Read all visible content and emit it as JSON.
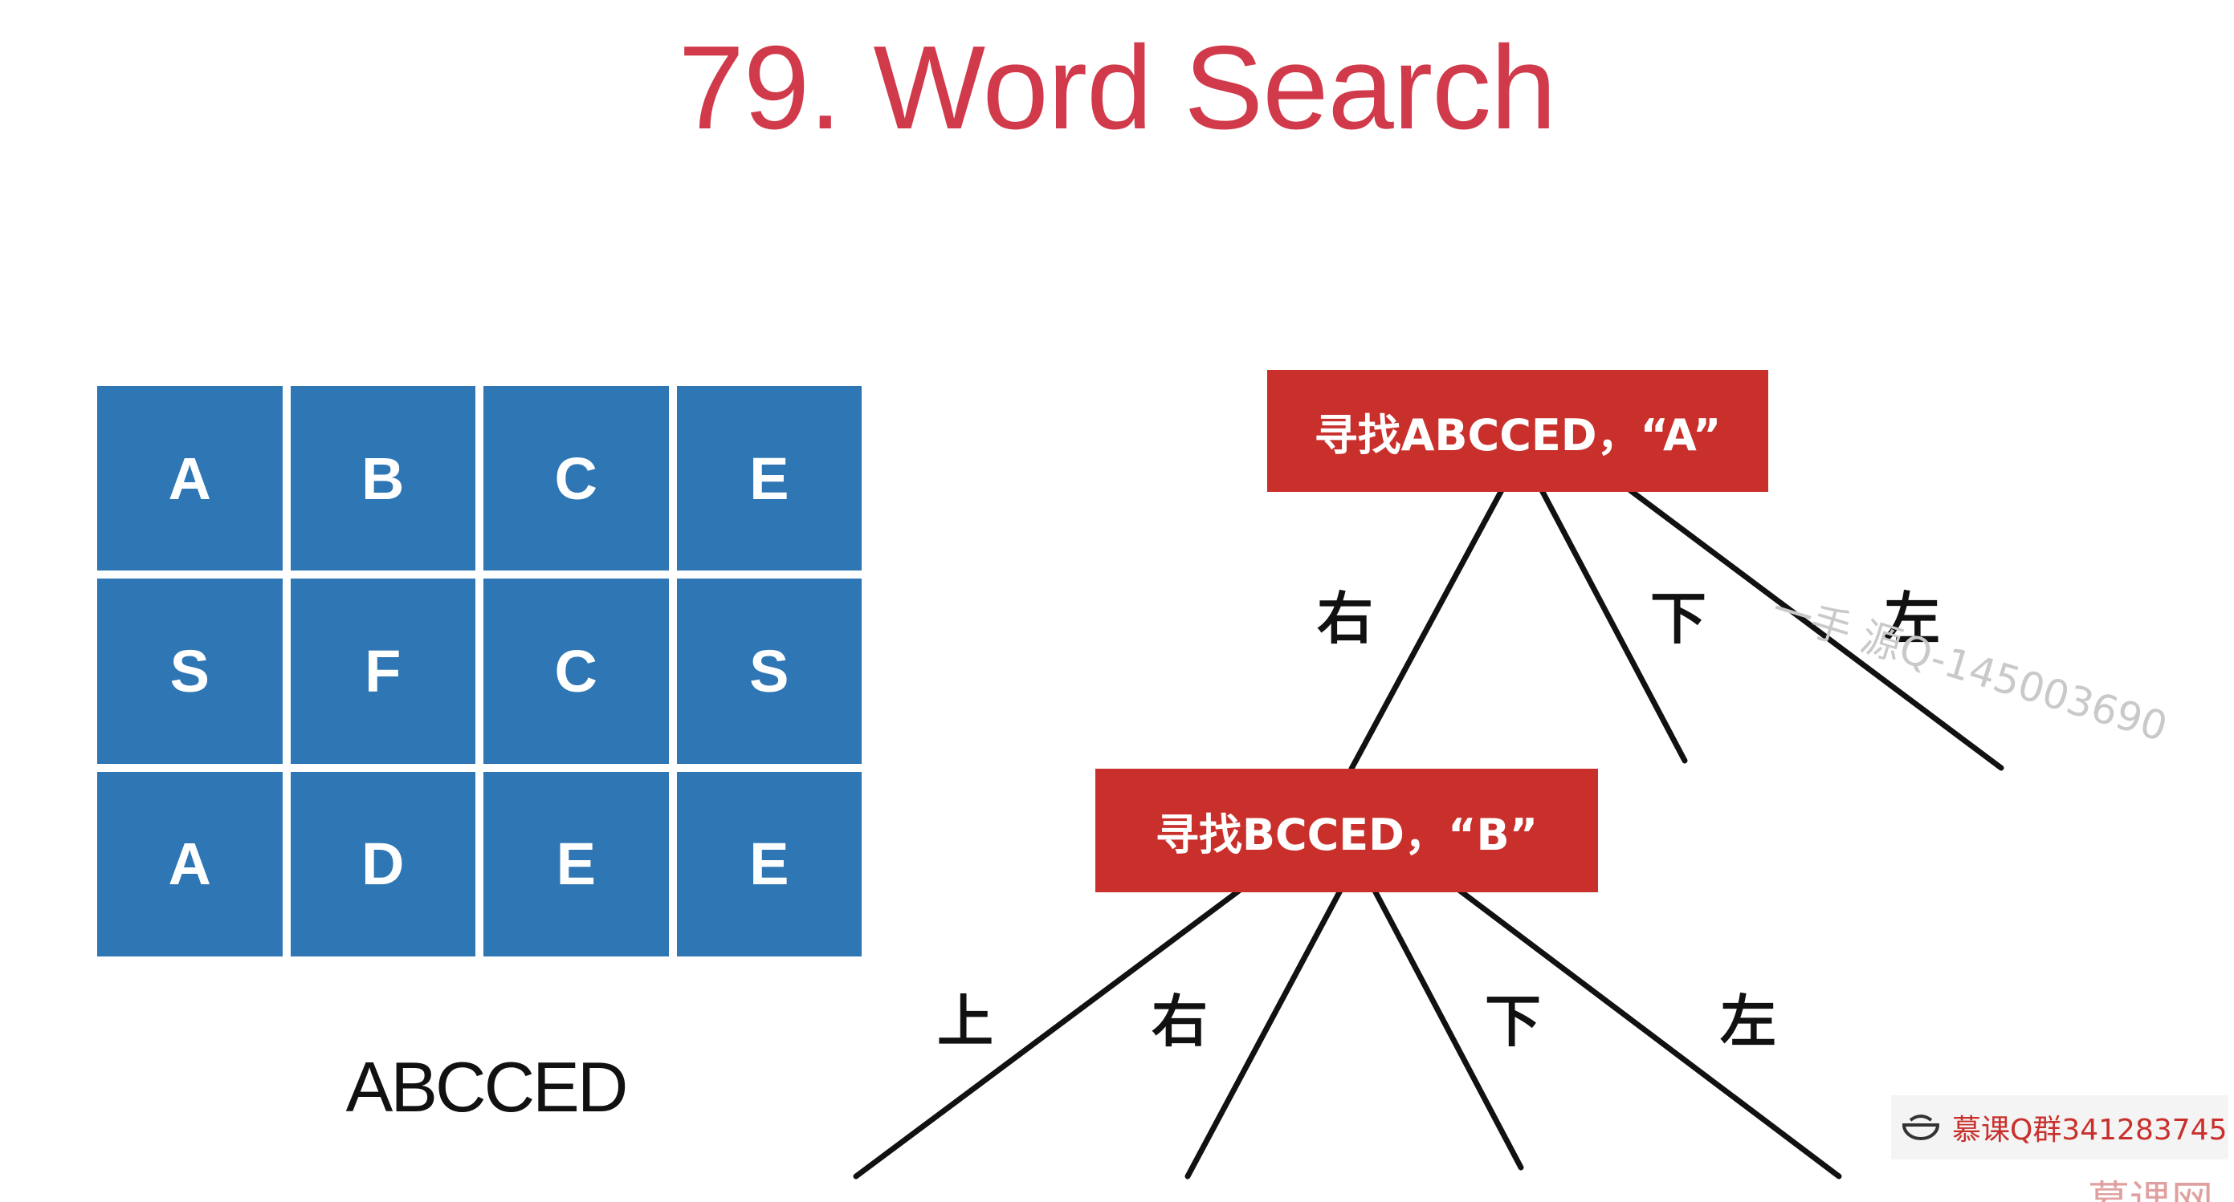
{
  "title": "79. Word Search",
  "board": [
    [
      "A",
      "B",
      "C",
      "E"
    ],
    [
      "S",
      "F",
      "C",
      "S"
    ],
    [
      "A",
      "D",
      "E",
      "E"
    ]
  ],
  "word": "ABCCED",
  "tree": {
    "root": {
      "label": "寻找ABCCED，“A”"
    },
    "root_edges": [
      "右",
      "下",
      "左"
    ],
    "child": {
      "label": "寻找BCCED，“B”"
    },
    "child_edges": [
      "上",
      "右",
      "下",
      "左"
    ]
  },
  "watermark": "一手 源Q-145003690",
  "badge": {
    "text": "慕课Q群341283745"
  },
  "brand": "慕课网",
  "colors": {
    "title": "#d13a4a",
    "cell": "#2f76b5",
    "node": "#c9302c"
  }
}
